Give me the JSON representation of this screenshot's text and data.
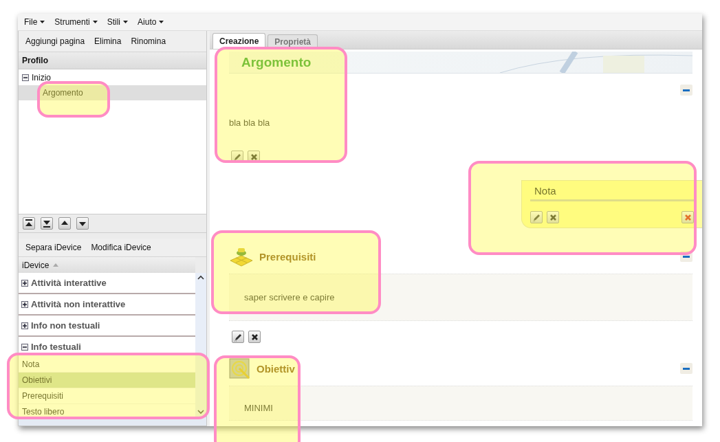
{
  "menu": [
    {
      "label": "File"
    },
    {
      "label": "Strumenti"
    },
    {
      "label": "Stili"
    },
    {
      "label": "Aiuto"
    }
  ],
  "outline_toolbar": [
    "Aggiungi pagina",
    "Elimina",
    "Rinomina"
  ],
  "outline": {
    "title": "Profilo",
    "tree": [
      {
        "label": "Inizio",
        "expanded": true,
        "selected": false,
        "children": [
          {
            "label": "Argomento",
            "selected": true
          }
        ]
      }
    ]
  },
  "idevice_toolbar": [
    "Separa iDevice",
    "Modifica iDevice"
  ],
  "idevice_list": {
    "header": "iDevice",
    "groups": [
      {
        "label": "Attività interattive",
        "expanded": false
      },
      {
        "label": "Attività non interattive",
        "expanded": false
      },
      {
        "label": "Info non testuali",
        "expanded": false
      },
      {
        "label": "Info testuali",
        "expanded": true,
        "items": [
          {
            "label": "Nota",
            "selected": false
          },
          {
            "label": "Obiettivi",
            "selected": true
          },
          {
            "label": "Prerequisiti",
            "selected": false
          },
          {
            "label": "Testo libero",
            "selected": false
          }
        ]
      }
    ]
  },
  "tabs": [
    {
      "label": "Creazione",
      "selected": true
    },
    {
      "label": "Proprietà",
      "selected": false
    }
  ],
  "page_title": "Argomento",
  "blocks": [
    {
      "kind": "text",
      "text": "bla bla bla"
    },
    {
      "kind": "note",
      "title": "Nota"
    },
    {
      "kind": "prerequisites",
      "title": "Prerequisiti",
      "text": "saper scrivere e capire"
    },
    {
      "kind": "objectives",
      "title": "Obiettiv",
      "text": "MINIMI"
    }
  ]
}
